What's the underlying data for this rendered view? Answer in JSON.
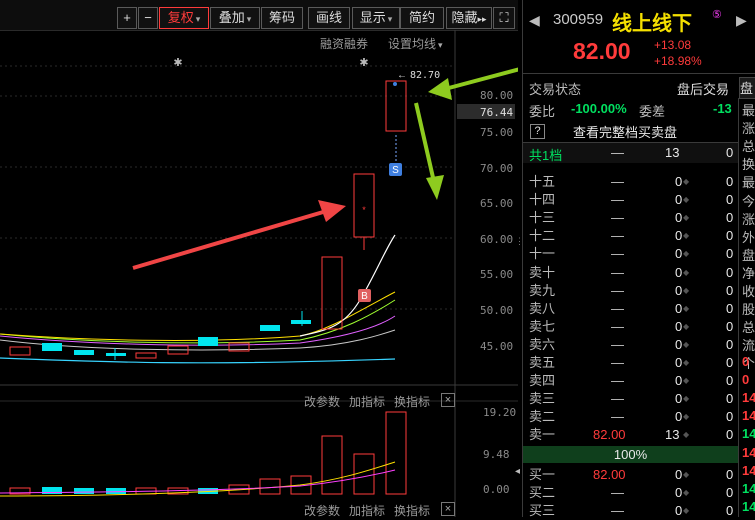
{
  "toolbar": {
    "plus": "+",
    "minus": "−",
    "fuquan": "复权",
    "diejia": "叠加",
    "chouma": "筹码",
    "huaxian": "画线",
    "xianshi": "显示",
    "jianyue": "简约",
    "yincang": "隐藏",
    "yincang_more": "▸▸",
    "expand_glyph": "⛶"
  },
  "chart_links": {
    "margin": "融资融券",
    "set_ma": "设置均线",
    "change_params_1": "改参数",
    "add_indicator_1": "加指标",
    "switch_indicator_1": "换指标",
    "change_params_2": "改参数",
    "add_indicator_2": "加指标",
    "switch_indicator_2": "换指标",
    "close": "×"
  },
  "price_axis": [
    "80.00",
    "75.00",
    "70.00",
    "65.00",
    "60.00",
    "55.00",
    "50.00",
    "45.00"
  ],
  "current_price_tag": "76.44",
  "high_label": "82.70",
  "vol_axis": [
    "19.20",
    "9.48",
    "0.00"
  ],
  "markers": {
    "sell": "S",
    "buy": "B",
    "star": "✱"
  },
  "stock": {
    "code": "300959",
    "name": "线上线下",
    "badge": "⑤",
    "price": "82.00",
    "change": "+13.08",
    "change_pct": "+18.98%"
  },
  "trade_status": {
    "label": "交易状态",
    "value": "盘后交易",
    "tab": "盘"
  },
  "weibi": {
    "label": "委比",
    "value": "-100.00%",
    "wc_label": "委差",
    "wc_value": "-13"
  },
  "full_book": {
    "icon": "?",
    "label": "查看完整档买卖盘"
  },
  "level_total": {
    "label": "共1档",
    "price": "—",
    "vol": "13",
    "extra": "0"
  },
  "asks": [
    {
      "label": "十五",
      "price": "—",
      "vol": "0",
      "extra": "0"
    },
    {
      "label": "十四",
      "price": "—",
      "vol": "0",
      "extra": "0"
    },
    {
      "label": "十三",
      "price": "—",
      "vol": "0",
      "extra": "0"
    },
    {
      "label": "十二",
      "price": "—",
      "vol": "0",
      "extra": "0"
    },
    {
      "label": "十一",
      "price": "—",
      "vol": "0",
      "extra": "0"
    },
    {
      "label": "卖十",
      "price": "—",
      "vol": "0",
      "extra": "0"
    },
    {
      "label": "卖九",
      "price": "—",
      "vol": "0",
      "extra": "0"
    },
    {
      "label": "卖八",
      "price": "—",
      "vol": "0",
      "extra": "0"
    },
    {
      "label": "卖七",
      "price": "—",
      "vol": "0",
      "extra": "0"
    },
    {
      "label": "卖六",
      "price": "—",
      "vol": "0",
      "extra": "0"
    },
    {
      "label": "卖五",
      "price": "—",
      "vol": "0",
      "extra": "0"
    },
    {
      "label": "卖四",
      "price": "—",
      "vol": "0",
      "extra": "0"
    },
    {
      "label": "卖三",
      "price": "—",
      "vol": "0",
      "extra": "0"
    },
    {
      "label": "卖二",
      "price": "—",
      "vol": "0",
      "extra": "0"
    },
    {
      "label": "卖一",
      "price": "82.00",
      "vol": "13",
      "extra": "0"
    }
  ],
  "ratio_bar": "100%",
  "bids": [
    {
      "label": "买一",
      "price": "82.00",
      "vol": "0",
      "extra": "0"
    },
    {
      "label": "买二",
      "price": "—",
      "vol": "0",
      "extra": "0"
    },
    {
      "label": "买三",
      "price": "—",
      "vol": "0",
      "extra": "0"
    }
  ],
  "side_column": {
    "labels": [
      "最",
      "涨",
      "总",
      "换",
      "最",
      "今",
      "涨",
      "外",
      "盘",
      "净",
      "收",
      "股",
      "总",
      "流",
      "个"
    ],
    "values": [
      "0",
      "0",
      "14",
      "14",
      "14",
      "14",
      "14",
      "14",
      "14"
    ]
  },
  "colors": {
    "up": "#ff3b3b",
    "down": "#00e5ee",
    "arrow_green": "#8ecb1f",
    "arrow_red": "#f04545"
  }
}
